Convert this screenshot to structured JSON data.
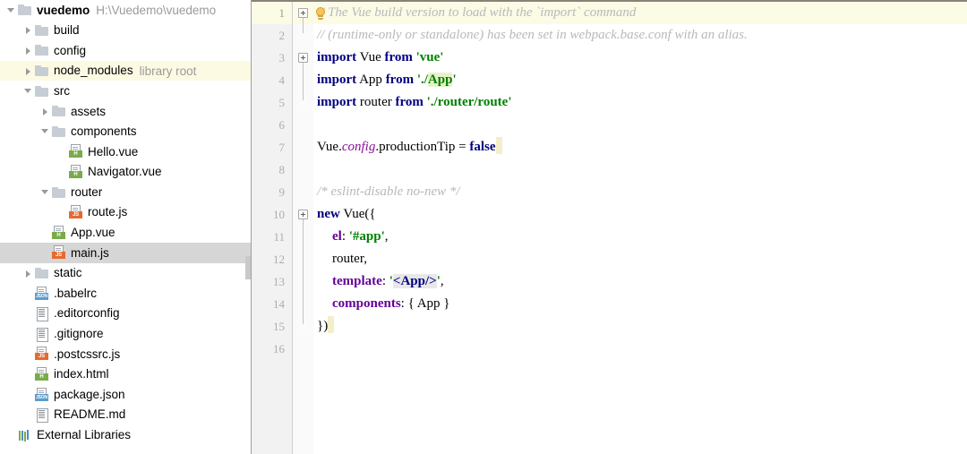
{
  "app": {
    "type": "ide",
    "title": "vuedemo"
  },
  "project_tree": {
    "scrollbar": true,
    "items": [
      {
        "id": "vuedemo",
        "label": "vuedemo",
        "sub": "H:\\Vuedemo\\vuedemo",
        "indent": 0,
        "twisty": "open",
        "icon": "folder-icon",
        "bold": true,
        "state": "normal"
      },
      {
        "id": "build",
        "label": "build",
        "sub": "",
        "indent": 1,
        "twisty": "closed",
        "icon": "folder-icon",
        "bold": false,
        "state": "normal"
      },
      {
        "id": "config",
        "label": "config",
        "sub": "",
        "indent": 1,
        "twisty": "closed",
        "icon": "folder-icon",
        "bold": false,
        "state": "normal"
      },
      {
        "id": "node_modules",
        "label": "node_modules",
        "sub": "library root",
        "indent": 1,
        "twisty": "closed",
        "icon": "folder-icon",
        "bold": false,
        "state": "library"
      },
      {
        "id": "src",
        "label": "src",
        "sub": "",
        "indent": 1,
        "twisty": "open",
        "icon": "folder-icon",
        "bold": false,
        "state": "normal"
      },
      {
        "id": "assets",
        "label": "assets",
        "sub": "",
        "indent": 2,
        "twisty": "closed",
        "icon": "folder-icon",
        "bold": false,
        "state": "normal"
      },
      {
        "id": "components",
        "label": "components",
        "sub": "",
        "indent": 2,
        "twisty": "open",
        "icon": "folder-icon",
        "bold": false,
        "state": "normal"
      },
      {
        "id": "Hello.vue",
        "label": "Hello.vue",
        "sub": "",
        "indent": 3,
        "twisty": "none",
        "icon": "vue-file-icon",
        "badge": "H",
        "badge_kind": "vue",
        "bold": false,
        "state": "normal"
      },
      {
        "id": "Navigator.vue",
        "label": "Navigator.vue",
        "sub": "",
        "indent": 3,
        "twisty": "none",
        "icon": "vue-file-icon",
        "badge": "H",
        "badge_kind": "vue",
        "bold": false,
        "state": "normal"
      },
      {
        "id": "router",
        "label": "router",
        "sub": "",
        "indent": 2,
        "twisty": "open",
        "icon": "folder-icon",
        "bold": false,
        "state": "normal"
      },
      {
        "id": "route.js",
        "label": "route.js",
        "sub": "",
        "indent": 3,
        "twisty": "none",
        "icon": "js-file-icon",
        "badge": "JS",
        "badge_kind": "js",
        "bold": false,
        "state": "normal"
      },
      {
        "id": "App.vue",
        "label": "App.vue",
        "sub": "",
        "indent": 2,
        "twisty": "none",
        "icon": "vue-file-icon",
        "badge": "H",
        "badge_kind": "vue",
        "bold": false,
        "state": "normal"
      },
      {
        "id": "main.js",
        "label": "main.js",
        "sub": "",
        "indent": 2,
        "twisty": "none",
        "icon": "js-file-icon",
        "badge": "JS",
        "badge_kind": "js",
        "bold": false,
        "state": "selected"
      },
      {
        "id": "static",
        "label": "static",
        "sub": "",
        "indent": 1,
        "twisty": "closed",
        "icon": "folder-icon",
        "bold": false,
        "state": "normal"
      },
      {
        "id": ".babelrc",
        "label": ".babelrc",
        "sub": "",
        "indent": 1,
        "twisty": "none",
        "icon": "json-file-icon",
        "badge": "JSON",
        "badge_kind": "json",
        "bold": false,
        "state": "normal"
      },
      {
        "id": ".editorconfig",
        "label": ".editorconfig",
        "sub": "",
        "indent": 1,
        "twisty": "none",
        "icon": "text-file-icon",
        "bold": false,
        "state": "normal"
      },
      {
        "id": ".gitignore",
        "label": ".gitignore",
        "sub": "",
        "indent": 1,
        "twisty": "none",
        "icon": "text-file-icon",
        "bold": false,
        "state": "normal"
      },
      {
        "id": ".postcssrc.js",
        "label": ".postcssrc.js",
        "sub": "",
        "indent": 1,
        "twisty": "none",
        "icon": "js-file-icon",
        "badge": "JS",
        "badge_kind": "js",
        "bold": false,
        "state": "normal"
      },
      {
        "id": "index.html",
        "label": "index.html",
        "sub": "",
        "indent": 1,
        "twisty": "none",
        "icon": "html-file-icon",
        "badge": "H",
        "badge_kind": "html",
        "bold": false,
        "state": "normal"
      },
      {
        "id": "package.json",
        "label": "package.json",
        "sub": "",
        "indent": 1,
        "twisty": "none",
        "icon": "json-file-icon",
        "badge": "JSON",
        "badge_kind": "json",
        "bold": false,
        "state": "normal"
      },
      {
        "id": "README.md",
        "label": "README.md",
        "sub": "",
        "indent": 1,
        "twisty": "none",
        "icon": "text-file-icon",
        "bold": false,
        "state": "normal"
      },
      {
        "id": "external-libraries",
        "label": "External Libraries",
        "sub": "",
        "indent": 0,
        "twisty": "none",
        "icon": "libraries-icon",
        "bold": false,
        "state": "normal"
      }
    ]
  },
  "editor": {
    "file": "main.js",
    "current_line": 1,
    "intention_bulb": true,
    "line_numbers": [
      1,
      2,
      3,
      4,
      5,
      6,
      7,
      8,
      9,
      10,
      11,
      12,
      13,
      14,
      15,
      16
    ],
    "lines": [
      {
        "n": 1,
        "indent": 0,
        "tokens": [
          {
            "t": "// The Vue build version to load with the `import` command",
            "c": "cmt"
          }
        ]
      },
      {
        "n": 2,
        "indent": 0,
        "tokens": [
          {
            "t": "// (runtime-only or standalone) has been set in webpack.base.conf with an alias.",
            "c": "cmt"
          }
        ]
      },
      {
        "n": 3,
        "indent": 0,
        "tokens": [
          {
            "t": "import",
            "c": "kw"
          },
          {
            "t": " Vue ",
            "c": "plain"
          },
          {
            "t": "from",
            "c": "kw"
          },
          {
            "t": " ",
            "c": "plain"
          },
          {
            "t": "'vue'",
            "c": "str"
          }
        ]
      },
      {
        "n": 4,
        "indent": 0,
        "tokens": [
          {
            "t": "import",
            "c": "kw"
          },
          {
            "t": " App ",
            "c": "plain"
          },
          {
            "t": "from",
            "c": "kw"
          },
          {
            "t": " ",
            "c": "plain"
          },
          {
            "t": "'./",
            "c": "str"
          },
          {
            "t": "App",
            "c": "str hl-app"
          },
          {
            "t": "'",
            "c": "str"
          }
        ]
      },
      {
        "n": 5,
        "indent": 0,
        "tokens": [
          {
            "t": "import",
            "c": "kw"
          },
          {
            "t": " router ",
            "c": "plain"
          },
          {
            "t": "from",
            "c": "kw"
          },
          {
            "t": " ",
            "c": "plain"
          },
          {
            "t": "'./router/route'",
            "c": "str"
          }
        ]
      },
      {
        "n": 6,
        "indent": 0,
        "tokens": []
      },
      {
        "n": 7,
        "indent": 0,
        "tokens": [
          {
            "t": "Vue.",
            "c": "plain"
          },
          {
            "t": "config",
            "c": "fld"
          },
          {
            "t": ".productionTip = ",
            "c": "plain"
          },
          {
            "t": "false",
            "c": "kw"
          },
          {
            "t": "",
            "c": "caret"
          }
        ]
      },
      {
        "n": 8,
        "indent": 0,
        "tokens": []
      },
      {
        "n": 9,
        "indent": 0,
        "tokens": [
          {
            "t": "/* eslint-disable no-new */",
            "c": "cmt"
          }
        ]
      },
      {
        "n": 10,
        "indent": 0,
        "tokens": [
          {
            "t": "new",
            "c": "kw"
          },
          {
            "t": " Vue({",
            "c": "plain"
          }
        ]
      },
      {
        "n": 11,
        "indent": 1,
        "tokens": [
          {
            "t": "el",
            "c": "prop"
          },
          {
            "t": ": ",
            "c": "plain"
          },
          {
            "t": "'#app'",
            "c": "str"
          },
          {
            "t": ",",
            "c": "plain"
          }
        ]
      },
      {
        "n": 12,
        "indent": 1,
        "tokens": [
          {
            "t": "router,",
            "c": "plain"
          }
        ]
      },
      {
        "n": 13,
        "indent": 1,
        "tokens": [
          {
            "t": "template",
            "c": "prop"
          },
          {
            "t": ": ",
            "c": "plain"
          },
          {
            "t": "'",
            "c": "str"
          },
          {
            "t": "<App/>",
            "c": "tag hl-tag"
          },
          {
            "t": "'",
            "c": "str"
          },
          {
            "t": ",",
            "c": "plain"
          }
        ]
      },
      {
        "n": 14,
        "indent": 1,
        "tokens": [
          {
            "t": "components",
            "c": "prop"
          },
          {
            "t": ": { App }",
            "c": "plain"
          }
        ]
      },
      {
        "n": 15,
        "indent": 0,
        "tokens": [
          {
            "t": "})",
            "c": "plain"
          },
          {
            "t": "",
            "c": "caret"
          }
        ]
      },
      {
        "n": 16,
        "indent": 0,
        "tokens": []
      }
    ],
    "fold_markers": [
      {
        "line": 1,
        "kind": "open"
      },
      {
        "line": 2,
        "kind": "arrow"
      },
      {
        "line": 3,
        "kind": "open"
      },
      {
        "line": 5,
        "kind": "arrow"
      },
      {
        "line": 10,
        "kind": "open"
      },
      {
        "line": 15,
        "kind": "arrow"
      }
    ],
    "colors": {
      "keyword": "#000080",
      "string": "#008000",
      "comment": "#b9b9b9",
      "property": "#660099",
      "field": "#871094",
      "current_line_bg": "#fcfbe6",
      "gutter_bg": "#f2f2f2",
      "selection_bg": "#d6d6d6",
      "library_row_bg": "#fdfae3",
      "app_highlight_bg": "#e8f2c8",
      "tag_highlight_bg": "#e8e8e8"
    }
  }
}
